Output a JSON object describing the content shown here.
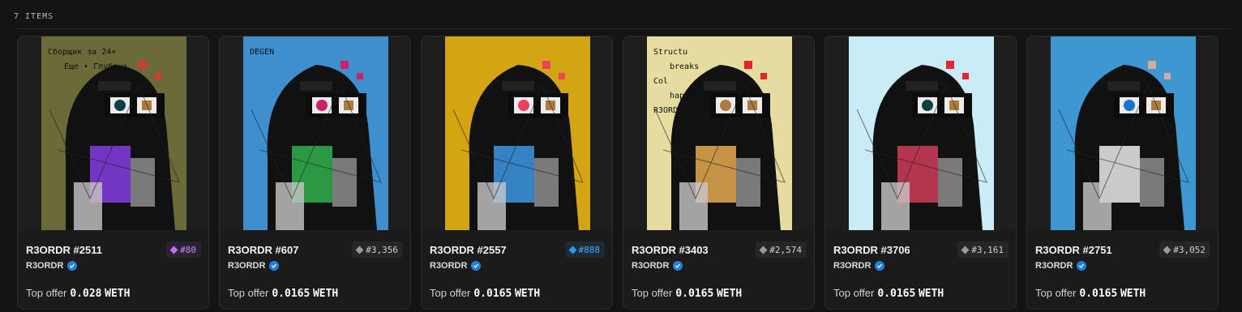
{
  "header": {
    "items_count": "7 ITEMS"
  },
  "cards": [
    {
      "name": "R3ORDR #2511",
      "rank": "#80",
      "rank_tier": "purple",
      "collection": "R3ORDR",
      "offer_label": "Top offer",
      "offer_value": "0.028",
      "offer_currency": "WETH",
      "art": {
        "bg": "#6b6b3a",
        "accent": "#d73a2a",
        "eye": "#0f3f45",
        "face": "#7d3bd6",
        "texts": [
          "Сборщик за 24+",
          "Еще • Глубина"
        ]
      }
    },
    {
      "name": "R3ORDR #607",
      "rank": "#3,356",
      "rank_tier": "default",
      "collection": "R3ORDR",
      "offer_label": "Top offer",
      "offer_value": "0.0165",
      "offer_currency": "WETH",
      "art": {
        "bg": "#3f8fcf",
        "accent": "#d21f6a",
        "eye": "#d21f6a",
        "face": "#2fa84a",
        "texts": [
          "DEGEN"
        ]
      }
    },
    {
      "name": "R3ORDR #2557",
      "rank": "#888",
      "rank_tier": "blue",
      "collection": "R3ORDR",
      "offer_label": "Top offer",
      "offer_value": "0.0165",
      "offer_currency": "WETH",
      "art": {
        "bg": "#d4a513",
        "accent": "#ef4060",
        "eye": "#ef4060",
        "face": "#3a8fd8",
        "texts": []
      }
    },
    {
      "name": "R3ORDR #3403",
      "rank": "#2,574",
      "rank_tier": "default",
      "collection": "R3ORDR",
      "offer_label": "Top offer",
      "offer_value": "0.0165",
      "offer_currency": "WETH",
      "art": {
        "bg": "#e7dca0",
        "accent": "#e8232e",
        "eye": "#b07a3a",
        "face": "#d9a24d",
        "texts": [
          "Structu",
          "breaks",
          "Col",
          "happens.",
          "R3ORDR"
        ]
      }
    },
    {
      "name": "R3ORDR #3706",
      "rank": "#3,161",
      "rank_tier": "default",
      "collection": "R3ORDR",
      "offer_label": "Top offer",
      "offer_value": "0.0165",
      "offer_currency": "WETH",
      "art": {
        "bg": "#c9ecf7",
        "accent": "#e8232e",
        "eye": "#0f3f45",
        "face": "#c73a55",
        "texts": []
      }
    },
    {
      "name": "R3ORDR #2751",
      "rank": "#3,052",
      "rank_tier": "default",
      "collection": "R3ORDR",
      "offer_label": "Top offer",
      "offer_value": "0.0165",
      "offer_currency": "WETH",
      "art": {
        "bg": "#3f97d2",
        "accent": "#d9a9a0",
        "eye": "#1f6fcf",
        "face": "#e0e0e0",
        "texts": []
      }
    }
  ]
}
